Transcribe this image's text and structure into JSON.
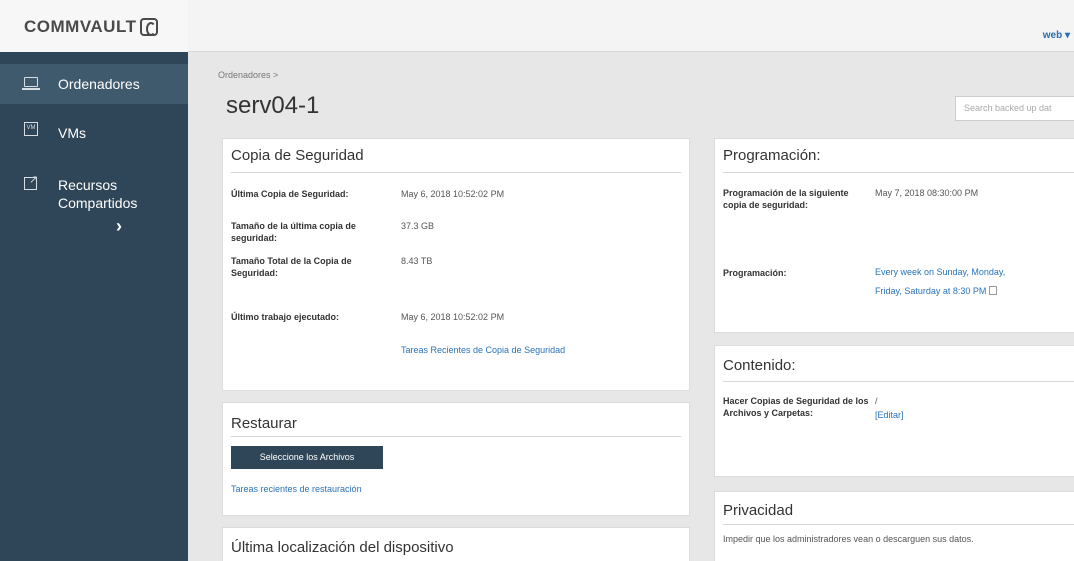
{
  "header": {
    "logo": "COMMVAULT",
    "user": "web ▾"
  },
  "sidebar": {
    "items": [
      {
        "label": "Ordenadores",
        "icon": "laptop-icon"
      },
      {
        "label": "VMs",
        "icon": "vm-icon"
      },
      {
        "label": "Recursos Compartidos",
        "icon": "share-icon"
      }
    ],
    "chevron": "›"
  },
  "breadcrumb": "Ordenadores >",
  "page_title": "serv04-1",
  "search": {
    "placeholder": "Search backed up dat"
  },
  "backup_card": {
    "title": "Copia de Seguridad",
    "rows": [
      {
        "label": "Última Copia de Seguridad:",
        "value": "May 6, 2018 10:52:02 PM"
      },
      {
        "label": "Tamaño de la última copia de seguridad:",
        "value": "37.3 GB"
      },
      {
        "label": "Tamaño Total de la Copia de Seguridad:",
        "value": "8.43 TB"
      },
      {
        "label": "Último trabajo ejecutado:",
        "value": "May 6, 2018 10:52:02 PM"
      }
    ],
    "recent_link": "Tareas Recientes de Copia de Seguridad"
  },
  "restore_card": {
    "title": "Restaurar",
    "button": "Seleccione los Archivos",
    "recent_link": "Tareas recientes de restauración"
  },
  "location_card": {
    "title": "Última localización del dispositivo"
  },
  "schedule_card": {
    "title": "Programación:",
    "next_label": "Programación de la siguiente copia de seguridad:",
    "next_value": "May 7, 2018 08:30:00 PM",
    "schedule_label": "Programación:",
    "schedule_value_1": "Every week on Sunday, Monday,",
    "schedule_value_2": "Friday, Saturday at 8:30 PM"
  },
  "content_card": {
    "title": "Contenido:",
    "label": "Hacer Copias de Seguridad de los Archivos y Carpetas:",
    "value": "/",
    "edit_link": "[Editar]"
  },
  "privacy_card": {
    "title": "Privacidad",
    "text": "Impedir que los administradores vean o descarguen sus datos."
  }
}
